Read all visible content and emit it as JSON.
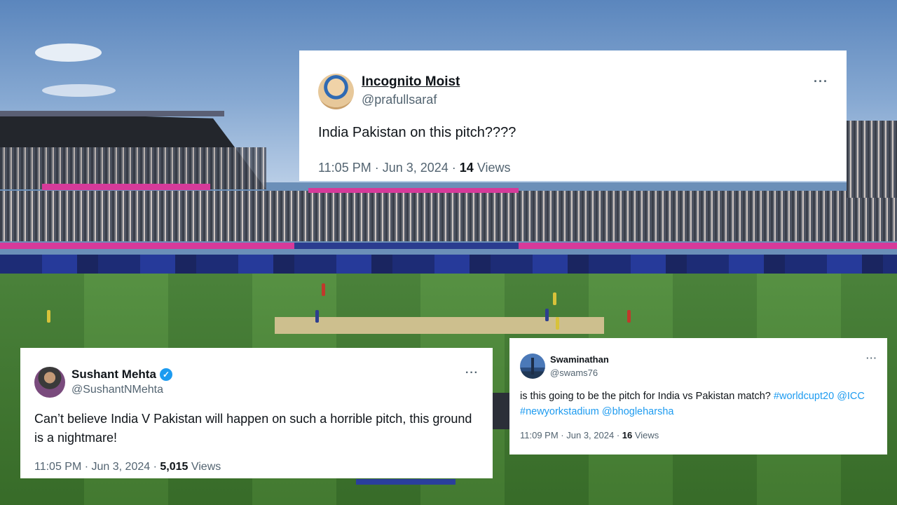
{
  "tweets": [
    {
      "name": "Incognito Moist",
      "handle": "@prafullsaraf",
      "verified": false,
      "text": "India Pakistan on this pitch????",
      "time": "11:05 PM",
      "date": "Jun 3, 2024",
      "views_count": "14",
      "views_label": "Views",
      "avatar_icon": "cartoon-face-avatar"
    },
    {
      "name": "Sushant Mehta",
      "handle": "@SushantNMehta",
      "verified": true,
      "text": "Can’t believe India V Pakistan will happen on such a horrible pitch, this ground is a nightmare!",
      "time": "11:05 PM",
      "date": "Jun 3, 2024",
      "views_count": "5,015",
      "views_label": "Views",
      "avatar_icon": "person-photo-avatar"
    },
    {
      "name": "Swaminathan",
      "handle": "@swams76",
      "verified": false,
      "text_plain": "is this going to be the pitch for India vs Pakistan match?",
      "hashtag1": "#worldcupt20",
      "mention1": "@ICC",
      "hashtag2": "#newyorkstadium",
      "mention2": "@bhogleharsha",
      "time": "11:09 PM",
      "date": "Jun 3, 2024",
      "views_count": "16",
      "views_label": "Views",
      "avatar_icon": "skyline-avatar"
    }
  ],
  "separator": " · ",
  "more_icon": "···",
  "verified_icon": "✓",
  "colors": {
    "link": "#1d9bf0",
    "text": "#0f1419",
    "muted": "#536471",
    "verified": "#1d9bf0",
    "pitch": "#cdbf8e",
    "grass": "#4c8a37",
    "banner": "#d63a9a"
  }
}
